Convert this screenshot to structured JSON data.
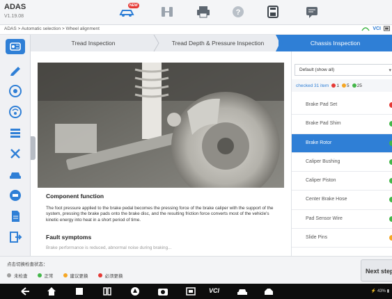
{
  "app": {
    "name": "ADAS",
    "version": "V1.19.08"
  },
  "toolbar": {
    "badge": "NEW"
  },
  "breadcrumb": "ADAS > Automatic selection > Wheel alignment",
  "vci": {
    "label": "VCI"
  },
  "tabs": [
    {
      "label": "Tread Inspection",
      "active": false
    },
    {
      "label": "Tread Depth & Pressure Inspection",
      "active": false
    },
    {
      "label": "Chassis Inspection",
      "active": true
    }
  ],
  "content": {
    "component_function_title": "Component function",
    "component_function_text": "The foot pressure applied to the brake pedal becomes the pressing force of the brake caliper with the support of the system, pressing the brake pads onto the brake disc, and the resulting friction force converts most of the vehicle's kinetic energy into heat in a short period of time.",
    "fault_symptoms_title": "Fault symptoms",
    "fault_symptoms_partial": "Brake performance is reduced, abnormal noise during braking..."
  },
  "right_panel": {
    "filter_value": "Default (show all)",
    "checked_label": "checked 31 item",
    "counts": [
      {
        "value": "1",
        "color": "#e53935"
      },
      {
        "value": "5",
        "color": "#f5a623"
      },
      {
        "value": "25",
        "color": "#43b649"
      }
    ],
    "items": [
      {
        "label": "Brake Pad Set",
        "status_color": "#e53935",
        "selected": false
      },
      {
        "label": "Brake Pad Shim",
        "status_color": "#43b649",
        "selected": false
      },
      {
        "label": "Brake Rotor",
        "status_color": "#43b649",
        "selected": true
      },
      {
        "label": "Caliper Bushing",
        "status_color": "#43b649",
        "selected": false
      },
      {
        "label": "Caliper Piston",
        "status_color": "#43b649",
        "selected": false
      },
      {
        "label": "Center Brake Hose",
        "status_color": "#43b649",
        "selected": false
      },
      {
        "label": "Pad Sensor Wire",
        "status_color": "#43b649",
        "selected": false
      },
      {
        "label": "Slide Pins",
        "status_color": "#f5a623",
        "selected": false
      }
    ]
  },
  "footer": {
    "hint": "点击切换检查状态：",
    "legend": [
      {
        "label": "未检查",
        "color": "#9e9e9e"
      },
      {
        "label": "正常",
        "color": "#43b649"
      },
      {
        "label": "建议更换",
        "color": "#f5a623"
      },
      {
        "label": "必须更换",
        "color": "#e53935"
      }
    ],
    "next_label": "Next step"
  },
  "navbar": {
    "vci_text": "VCI"
  },
  "status_bar": {
    "text": "⚡ 43% ▮"
  },
  "colors": {
    "accent": "#2f7fd6",
    "red": "#e53935",
    "orange": "#f5a623",
    "green": "#43b649"
  }
}
